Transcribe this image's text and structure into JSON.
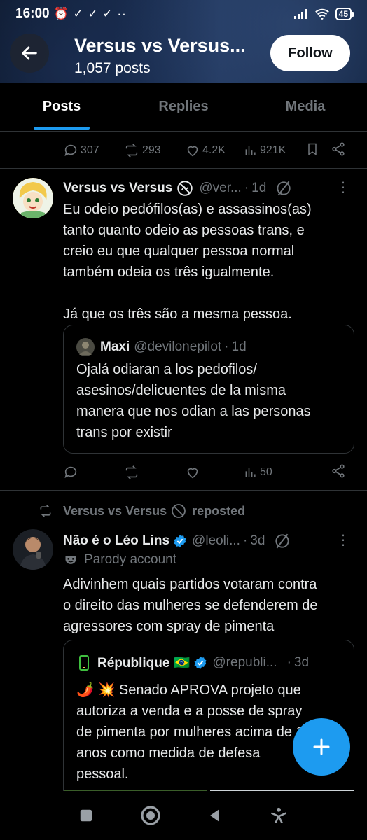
{
  "status_bar": {
    "time": "16:00",
    "indicators": "⏰ ✓ ✓ ✓  ··",
    "battery": "45"
  },
  "header": {
    "title": "Versus vs Versus...",
    "subtitle": "1,057 posts",
    "follow_label": "Follow"
  },
  "tabs": [
    {
      "label": "Posts",
      "active": true
    },
    {
      "label": "Replies",
      "active": false
    },
    {
      "label": "Media",
      "active": false
    }
  ],
  "top_actions": {
    "replies": "307",
    "reposts": "293",
    "likes": "4.2K",
    "views": "921K"
  },
  "tweet1": {
    "name": "Versus vs Versus",
    "handle": "@ver...",
    "time": "1d",
    "text_lines": [
      "Eu odeio pedófilos(as) e assassinos(as)",
      "tanto quanto odeio as pessoas trans, e",
      "creio eu que qualquer pessoa normal",
      "também odeia os três igualmente.",
      "",
      "Já que os três são a mesma pessoa."
    ],
    "quote": {
      "name": "Maxi",
      "handle": "@devilonepilot",
      "time": "1d",
      "text_lines": [
        "Ojalá odiaran a los pedofilos/",
        "asesinos/delicuentes de la misma",
        "manera que nos odian a las personas",
        "trans por existir"
      ]
    },
    "actions": {
      "views": "50"
    }
  },
  "tweet2": {
    "repost_label": "Versus vs Versus",
    "repost_suffix": "reposted",
    "name": "Não é o Léo Lins",
    "handle": "@leoli...",
    "time": "3d",
    "parody_label": "Parody account",
    "text_lines": [
      "Adivinhem quais partidos votaram contra",
      "o direito das mulheres se defenderem de",
      "agressores com spray de pimenta"
    ],
    "quote": {
      "name": "République 🇧🇷",
      "handle": "@republi...",
      "time": "3d",
      "text_lines": [
        "🌶️ 💥 Senado APROVA projeto que",
        "autoriza a venda e a posse de spray",
        "de pimenta por mulheres acima de 16",
        "anos como medida de defesa",
        "pessoal."
      ]
    }
  },
  "colors": {
    "accent": "#1d9bf0",
    "background": "#000000",
    "muted": "#71767b",
    "divider": "#2f3336"
  }
}
